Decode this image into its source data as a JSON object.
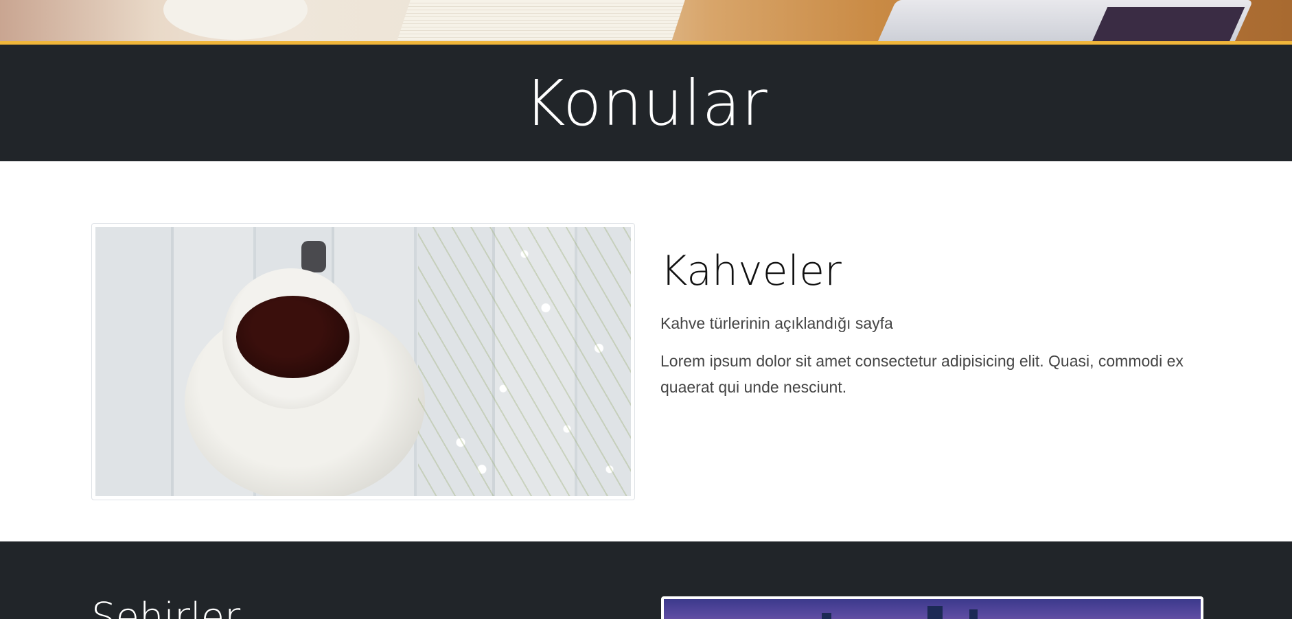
{
  "header": {
    "title": "Konular"
  },
  "topics": [
    {
      "title": "Kahveler",
      "subtitle": "Kahve türlerinin açıklandığı sayfa",
      "body": "Lorem ipsum dolor sit amet consectetur adipisicing elit. Quasi, commodi ex quaerat qui unde nesciunt.",
      "image_alt": "coffee-cup-photo"
    },
    {
      "title": "Şehirler",
      "image_alt": "city-skyline-photo"
    }
  ],
  "colors": {
    "accent": "#f0b63a",
    "dark_band": "#212529",
    "text_muted": "#444444"
  }
}
